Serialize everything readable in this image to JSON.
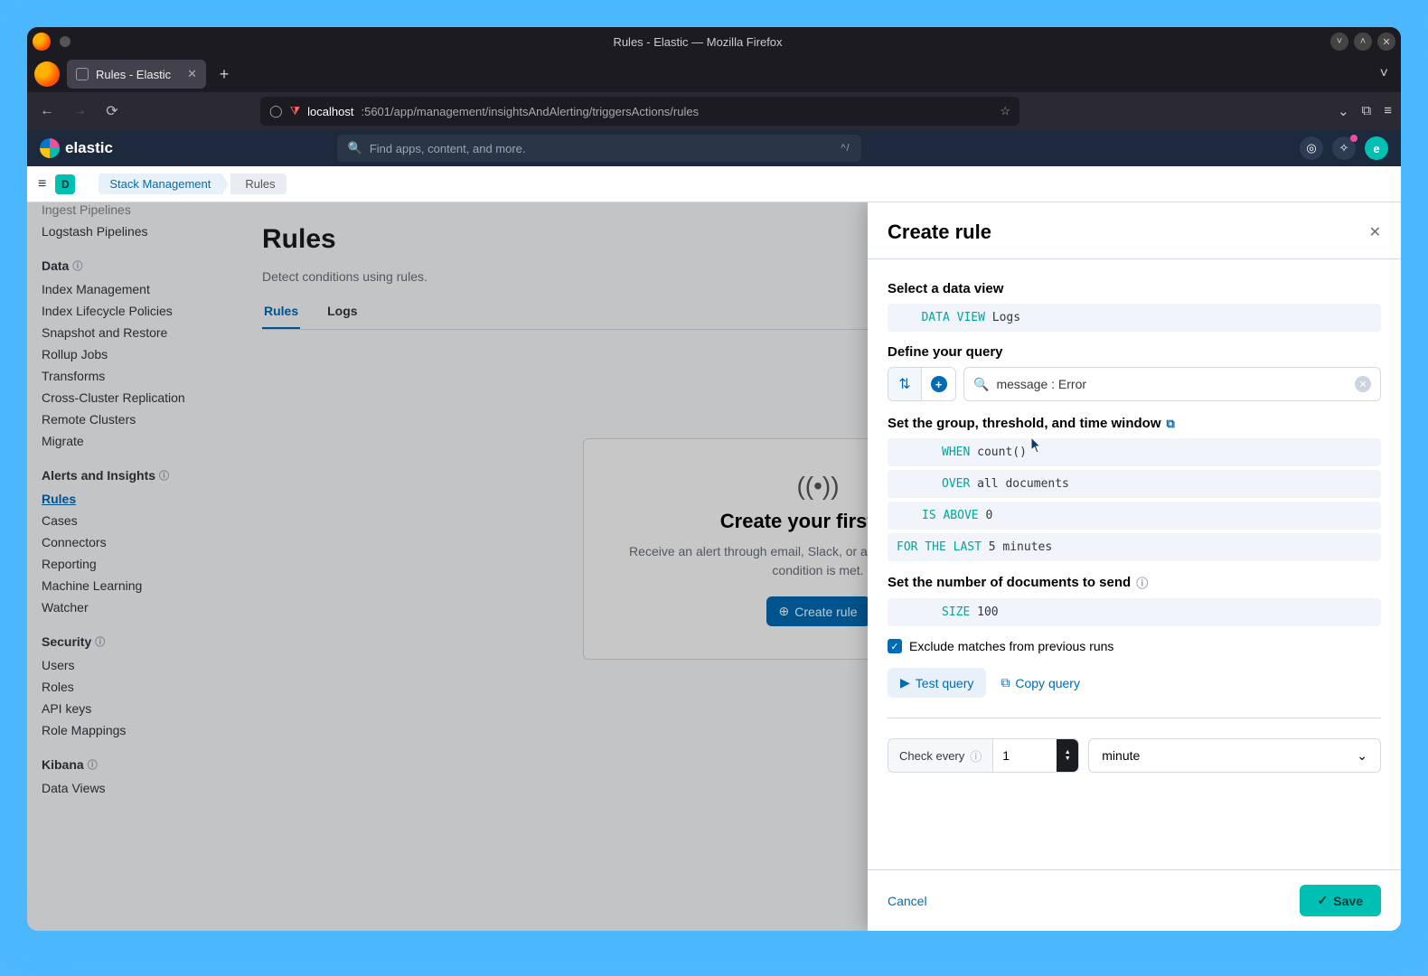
{
  "window": {
    "title": "Rules - Elastic — Mozilla Firefox"
  },
  "browser": {
    "tab_title": "Rules - Elastic",
    "url_host": "localhost",
    "url_path": ":5601/app/management/insightsAndAlerting/triggersActions/rules"
  },
  "header": {
    "brand": "elastic",
    "search_placeholder": "Find apps, content, and more.",
    "search_shortcut": "^/",
    "user_initial": "e"
  },
  "breadcrumb": {
    "badge": "D",
    "parent": "Stack Management",
    "leaf": "Rules"
  },
  "sidebar": {
    "top_items": [
      "Ingest Pipelines",
      "Logstash Pipelines"
    ],
    "cat_data": "Data",
    "data_items": [
      "Index Management",
      "Index Lifecycle Policies",
      "Snapshot and Restore",
      "Rollup Jobs",
      "Transforms",
      "Cross-Cluster Replication",
      "Remote Clusters",
      "Migrate"
    ],
    "cat_alerts": "Alerts and Insights",
    "alerts_items": [
      "Rules",
      "Cases",
      "Connectors",
      "Reporting",
      "Machine Learning",
      "Watcher"
    ],
    "cat_security": "Security",
    "security_items": [
      "Users",
      "Roles",
      "API keys",
      "Role Mappings"
    ],
    "cat_kibana": "Kibana",
    "kibana_items": [
      "Data Views"
    ]
  },
  "main": {
    "title": "Rules",
    "subtitle": "Detect conditions using rules.",
    "tabs": [
      "Rules",
      "Logs"
    ],
    "empty": {
      "title": "Create your first rule",
      "desc": "Receive an alert through email, Slack, or another connector when a condition is met.",
      "button": "Create rule"
    }
  },
  "flyout": {
    "title": "Create rule",
    "sect_dataview": "Select a data view",
    "dataview_kw": "DATA VIEW",
    "dataview_val": "Logs",
    "sect_query": "Define your query",
    "query_value": "message : Error",
    "sect_group": "Set the group, threshold, and time window",
    "when_kw": "WHEN",
    "when_val": "count()",
    "over_kw": "OVER",
    "over_val": "all documents",
    "above_kw": "IS ABOVE",
    "above_val": "0",
    "last_kw": "FOR THE LAST",
    "last_val": "5 minutes",
    "sect_docs": "Set the number of documents to send",
    "size_kw": "SIZE",
    "size_val": "100",
    "exclude_label": "Exclude matches from previous runs",
    "test_query": "Test query",
    "copy_query": "Copy query",
    "check_every_label": "Check every",
    "check_every_value": "1",
    "check_every_unit": "minute",
    "cancel": "Cancel",
    "save": "Save"
  }
}
